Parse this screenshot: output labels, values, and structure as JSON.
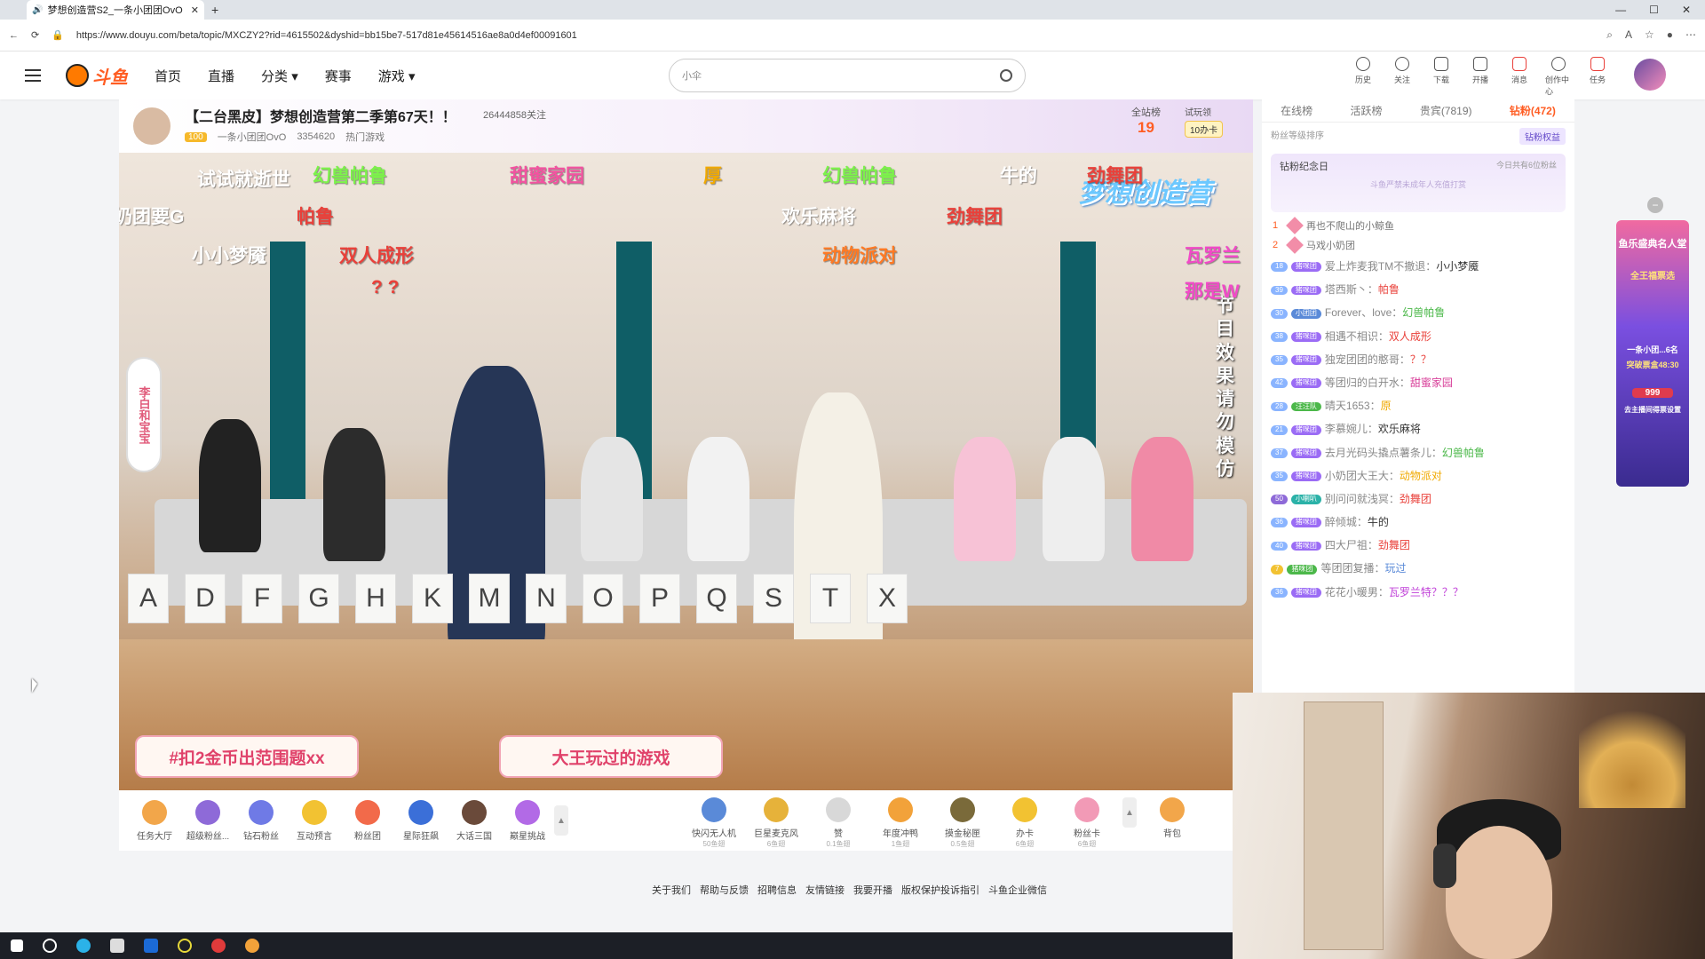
{
  "browser": {
    "tab_title": "梦想创造营S2_一条小团团OvO",
    "url": "https://www.douyu.com/beta/topic/MXCZY2?rid=4615502&dyshid=bb15be7-517d81e45614516ae8a0d4ef00091601"
  },
  "header": {
    "logo_text": "斗鱼",
    "nav": [
      "首页",
      "直播",
      "分类",
      "赛事",
      "游戏"
    ],
    "search_placeholder": "小伞",
    "tools": [
      {
        "label": "历史",
        "icon": "history-icon"
      },
      {
        "label": "关注",
        "icon": "heart-icon"
      },
      {
        "label": "下载",
        "icon": "download-icon"
      },
      {
        "label": "开播",
        "icon": "broadcast-icon"
      },
      {
        "label": "消息",
        "icon": "bell-icon"
      },
      {
        "label": "创作中心",
        "icon": "location-icon"
      },
      {
        "label": "任务",
        "icon": "gift-icon"
      }
    ]
  },
  "room": {
    "title": "【二台黑皮】梦想创造营第二季第67天！！",
    "followers": "26444858关注",
    "level": "100",
    "host": "一条小团团OvO",
    "hot": "3354620",
    "category": "热门游戏",
    "rank_label": "全站榜",
    "rank_value": "19",
    "trial_label": "试玩领",
    "trial_card": "10办卡"
  },
  "video": {
    "show_logo": "梦想创造营",
    "side_banner": "李白和宝宝",
    "vertical_note": "节目效果请勿模仿",
    "danmu": [
      {
        "text": "试试就逝世",
        "color": "#ffffff"
      },
      {
        "text": "幻兽帕鲁",
        "color": "#7cf24a"
      },
      {
        "text": "甜蜜家园",
        "color": "#f253a0"
      },
      {
        "text": "厚",
        "color": "#f0a900"
      },
      {
        "text": "幻兽帕鲁",
        "color": "#7cf24a"
      },
      {
        "text": "牛的",
        "color": "#ffffff"
      },
      {
        "text": "劲舞团",
        "color": "#e9403a"
      },
      {
        "text": "奶团要G",
        "color": "#ffffff"
      },
      {
        "text": "帕鲁",
        "color": "#e9403a"
      },
      {
        "text": "欢乐麻将",
        "color": "#ffffff"
      },
      {
        "text": "劲舞团",
        "color": "#e9403a"
      },
      {
        "text": "小小梦魇",
        "color": "#ffffff"
      },
      {
        "text": "双人成形",
        "color": "#e9403a"
      },
      {
        "text": "动物派对",
        "color": "#ff7a24"
      },
      {
        "text": "瓦罗兰",
        "color": "#f24ac8"
      },
      {
        "text": "? ?",
        "color": "#e9403a"
      },
      {
        "text": "那是W",
        "color": "#f24ac8"
      }
    ],
    "cards": [
      "A",
      "D",
      "F",
      "G",
      "H",
      "K",
      "M",
      "N",
      "O",
      "P",
      "Q",
      "S",
      "T",
      "X"
    ],
    "prompt_left": "#扣2金币出范围题xx",
    "prompt_right": "大王玩过的游戏"
  },
  "gifts_left": [
    {
      "label": "任务大厅",
      "color": "#f2a64a"
    },
    {
      "label": "超级粉丝...",
      "color": "#8e6ad8"
    },
    {
      "label": "钻石粉丝",
      "color": "#6f7ae6"
    },
    {
      "label": "互动预言",
      "color": "#f2c232"
    },
    {
      "label": "粉丝团",
      "color": "#f26a4a"
    },
    {
      "label": "星际狂飙",
      "color": "#3b6fd8"
    },
    {
      "label": "大话三国",
      "color": "#6a4a3a"
    },
    {
      "label": "巅星挑战",
      "color": "#b26ae6"
    }
  ],
  "gifts_right": [
    {
      "label": "快闪无人机",
      "price": "50鱼翅",
      "color": "#5a8ad8"
    },
    {
      "label": "巨星麦克风",
      "price": "6鱼翅",
      "color": "#e6b23a"
    },
    {
      "label": "赞",
      "price": "0.1鱼翅",
      "color": "#d8d8d8"
    },
    {
      "label": "年度冲鸭",
      "price": "1鱼翅",
      "color": "#f2a23a"
    },
    {
      "label": "摸金秘匣",
      "price": "0.5鱼翅",
      "color": "#7a6a3a"
    },
    {
      "label": "办卡",
      "price": "6鱼翅",
      "color": "#f2c232"
    },
    {
      "label": "粉丝卡",
      "price": "6鱼翅",
      "color": "#f29ab6"
    },
    {
      "label": "背包",
      "price": "",
      "color": "#f2a64a"
    }
  ],
  "chat": {
    "tabs": [
      "在线榜",
      "活跃榜",
      "贵宾(7819)",
      "钻粉(472)"
    ],
    "sort_label": "粉丝等级排序",
    "diamond_btn": "钻粉权益",
    "memday_title": "钻粉纪念日",
    "memday_count": "今日共有6位粉丝",
    "memday_hint": "斗鱼严禁未成年人充值打赏",
    "top": [
      {
        "n": "1",
        "name": "再也不爬山的小鲸鱼"
      },
      {
        "n": "2",
        "name": "马戏小奶团"
      }
    ],
    "messages": [
      {
        "lvl": "18",
        "name": "爱上炸麦我TM不撤退：",
        "text": "小小梦魇",
        "color": "#333333"
      },
      {
        "lvl": "39",
        "name": "塔西斯丶：",
        "text": "帕鲁",
        "color": "#e9403a"
      },
      {
        "lvl": "30",
        "name": "Forever、love：",
        "text": "幻兽帕鲁",
        "color": "#4cb84a"
      },
      {
        "lvl": "38",
        "name": "相遇不相识：",
        "text": "双人成形",
        "color": "#e9403a"
      },
      {
        "lvl": "35",
        "name": "独宠团团的憨哥：",
        "text": "？？",
        "color": "#e9403a"
      },
      {
        "lvl": "42",
        "name": "等团归的白开水：",
        "text": "甜蜜家园",
        "color": "#d8409a"
      },
      {
        "lvl": "28",
        "name": "晴天1653：",
        "text": "原",
        "color": "#f0a900"
      },
      {
        "lvl": "21",
        "name": "李慕婉儿：",
        "text": "欢乐麻将",
        "color": "#333333"
      },
      {
        "lvl": "37",
        "name": "去月光码头撬点薯条儿：",
        "text": "幻兽帕鲁",
        "color": "#4cb84a"
      },
      {
        "lvl": "35",
        "name": "小奶团大王大：",
        "text": "动物派对",
        "color": "#f0a900"
      },
      {
        "lvl": "50",
        "name": "别问问就浅冥：",
        "text": "劲舞团",
        "color": "#e9403a"
      },
      {
        "lvl": "36",
        "name": "醉倾城：",
        "text": "牛的",
        "color": "#333333"
      },
      {
        "lvl": "40",
        "name": "四大尸祖：",
        "text": "劲舞团",
        "color": "#e9403a"
      },
      {
        "lvl": "7",
        "name": "等团团复播：",
        "text": "玩过",
        "color": "#5a8ad8"
      },
      {
        "lvl": "36",
        "name": "花花小暖男：",
        "text": "瓦罗兰特？？？",
        "color": "#c040d8"
      }
    ]
  },
  "promo": {
    "title": "鱼乐盛典名人堂",
    "sub": "全王福票选",
    "host": "一条小团...6名",
    "time": "突破票盒48:30",
    "num": "999",
    "bottom": "去主播间得票设置"
  },
  "footer": [
    "关于我们",
    "帮助与反馈",
    "招聘信息",
    "友情链接",
    "我要开播",
    "版权保护投诉指引",
    "斗鱼企业微信"
  ]
}
